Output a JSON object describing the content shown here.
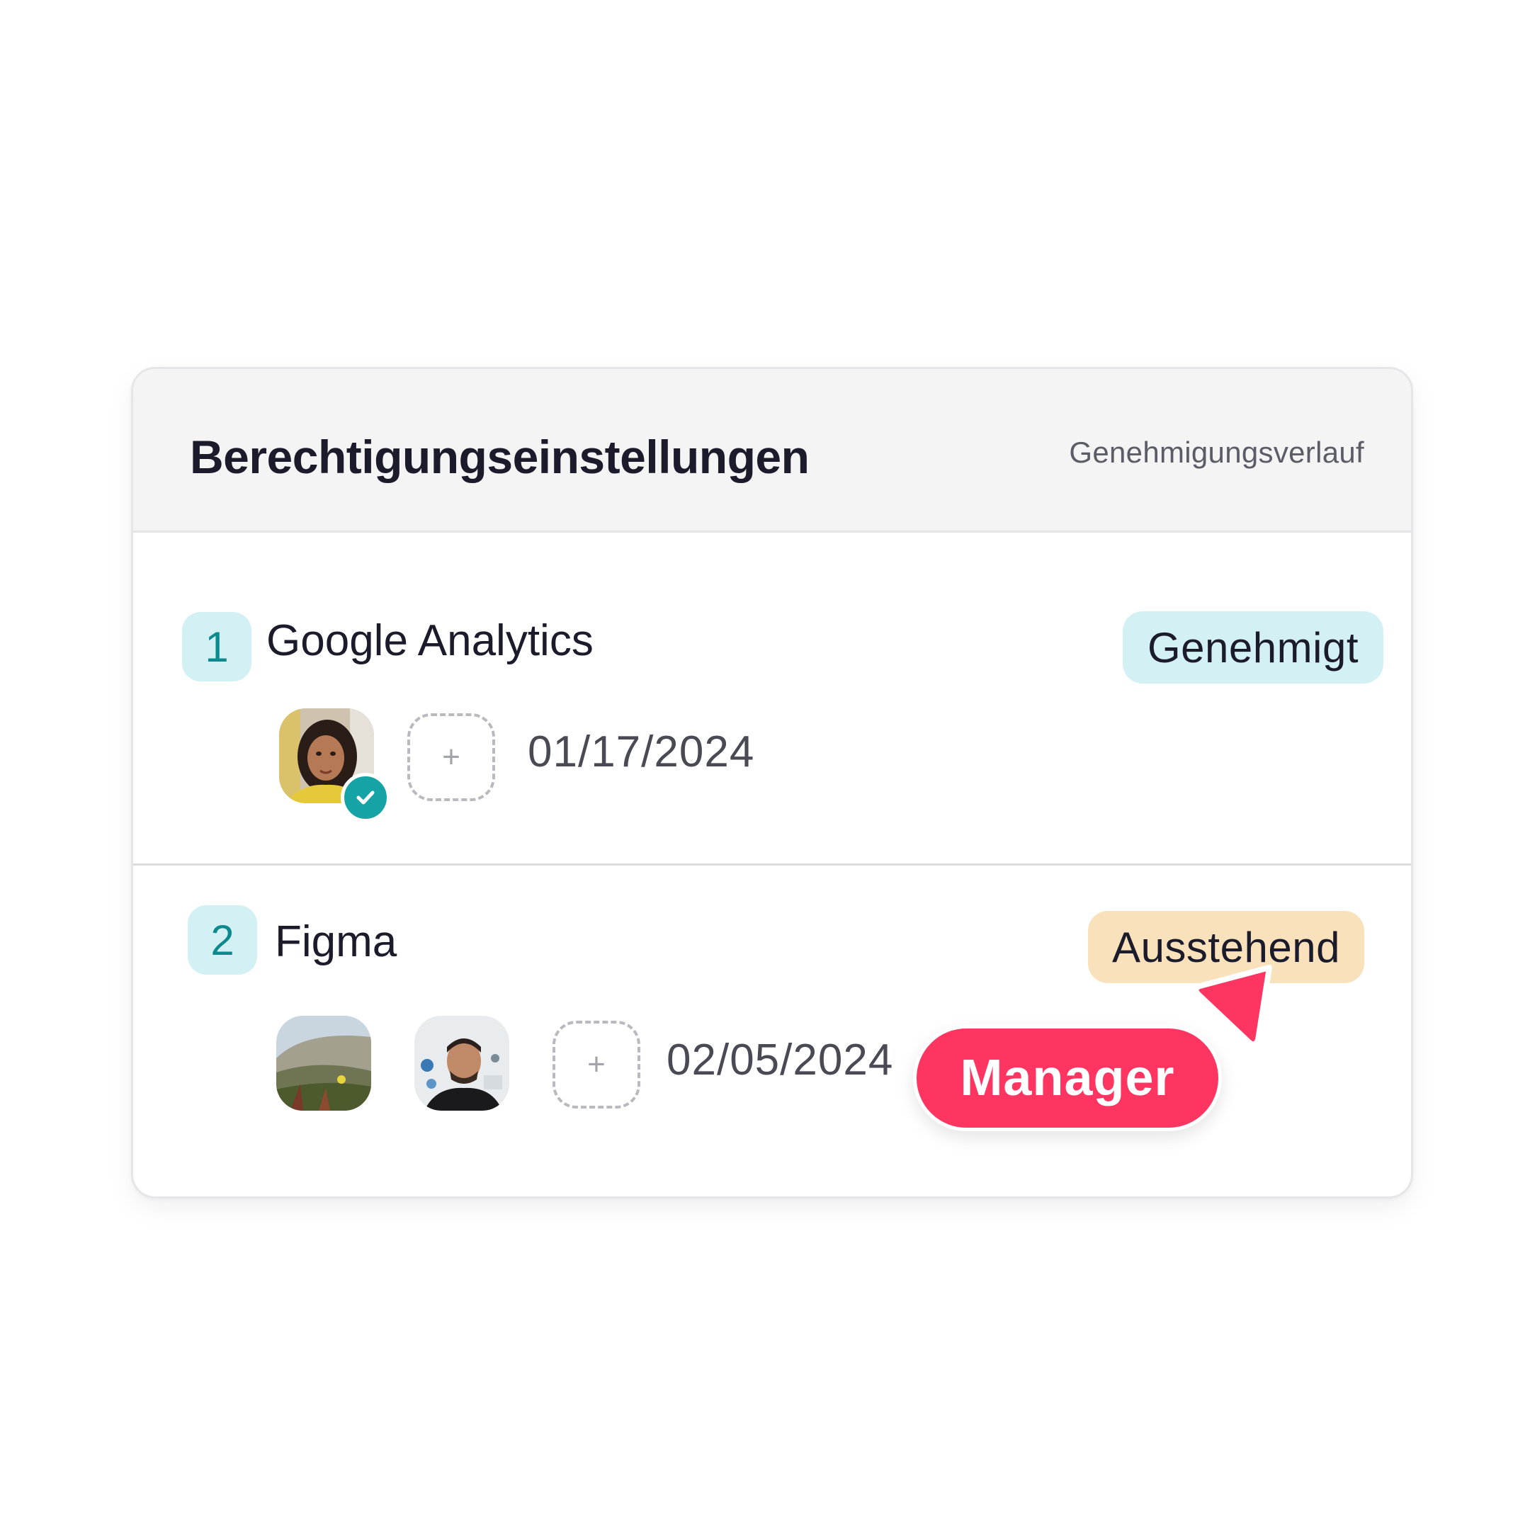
{
  "header": {
    "title": "Berechtigungseinstellungen",
    "history_link": "Genehmigungsverlauf"
  },
  "steps": [
    {
      "number": "1",
      "app": "Google Analytics",
      "status": "Genehmigt",
      "status_color": "#d3f1f4",
      "date": "01/17/2024",
      "approvers": [
        "avatar-woman-approved"
      ],
      "add_label": "+"
    },
    {
      "number": "2",
      "app": "Figma",
      "status": "Ausstehend",
      "status_color": "#f9e2bb",
      "date": "02/05/2024",
      "approvers": [
        "avatar-landscape",
        "avatar-man"
      ],
      "add_label": "+"
    }
  ],
  "cursor_tag": {
    "label": "Manager",
    "color": "#fd3560"
  },
  "colors": {
    "accent_teal": "#15a3a6",
    "badge_bg": "#d3f1f4",
    "header_bg": "#f4f4f5"
  }
}
